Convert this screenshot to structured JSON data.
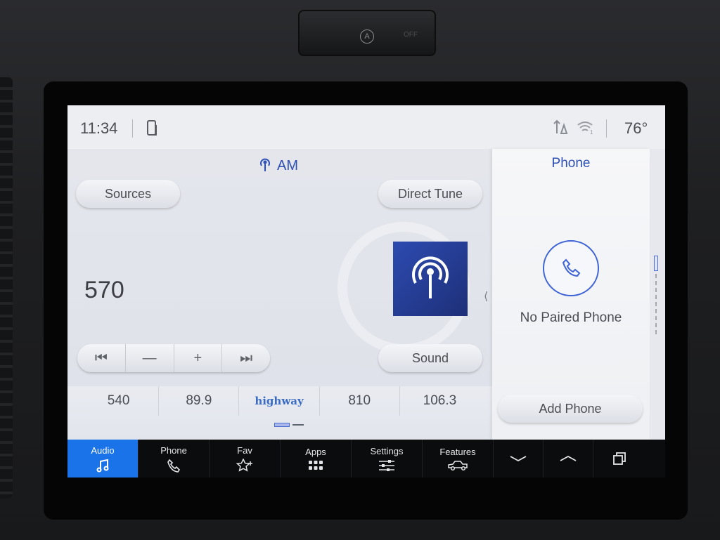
{
  "status_bar": {
    "time": "11:34",
    "temperature": "76°"
  },
  "audio": {
    "band": "AM",
    "sources_label": "Sources",
    "direct_tune_label": "Direct Tune",
    "frequency": "570",
    "sound_label": "Sound",
    "transport": [
      "seek-back-icon",
      "tune-down-icon",
      "tune-up-icon",
      "seek-forward-icon"
    ]
  },
  "presets": [
    {
      "label": "540"
    },
    {
      "label": "89.9"
    },
    {
      "label": "highway",
      "logo": true
    },
    {
      "label": "810"
    },
    {
      "label": "106.3"
    }
  ],
  "phone_panel": {
    "title": "Phone",
    "status": "No Paired Phone",
    "add_phone_label": "Add Phone"
  },
  "bottom_nav": [
    {
      "label": "Audio",
      "icon": "music-note-icon",
      "active": true
    },
    {
      "label": "Phone",
      "icon": "phone-icon",
      "active": false
    },
    {
      "label": "Fav",
      "icon": "star-plus-icon",
      "active": false
    },
    {
      "label": "Apps",
      "icon": "apps-grid-icon",
      "active": false
    },
    {
      "label": "Settings",
      "icon": "sliders-icon",
      "active": false
    },
    {
      "label": "Features",
      "icon": "truck-icon",
      "active": false
    }
  ],
  "colors": {
    "accent": "#2e4fb3",
    "nav_active": "#1a73e8",
    "station_art": "#2d4bb0"
  }
}
